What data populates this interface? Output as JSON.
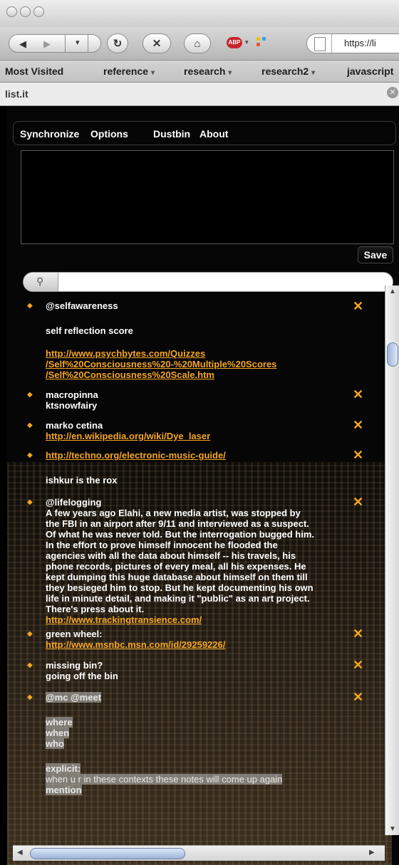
{
  "browser": {
    "url": "https://li",
    "adblock_label": "ABP",
    "bookmarks": [
      "Most Visited",
      "reference",
      "research",
      "research2",
      "javascript"
    ]
  },
  "sidebar": {
    "title": "list.it"
  },
  "menu": {
    "items": [
      "Synchronize",
      "Options",
      "Dustbin",
      "About"
    ]
  },
  "editor": {
    "save_label": "Save"
  },
  "notes": [
    {
      "lines": [
        "@selfawareness",
        "self reflection score"
      ],
      "links": [
        "http://www.psychbytes.com/Quizzes",
        "/Self%20Consciousness%20-%20Multiple%20Scores",
        "/Self%20Consciousness%20Scale.htm"
      ]
    },
    {
      "lines": [
        "macropinna",
        "ktsnowfairy"
      ]
    },
    {
      "lines": [
        "marko cetina"
      ],
      "links": [
        "http://en.wikipedia.org/wiki/Dye_laser"
      ]
    },
    {
      "links": [
        "http://techno.org/electronic-music-guide/"
      ],
      "lines": [
        "ishkur is the rox"
      ]
    },
    {
      "lines": [
        "@lifelogging",
        "A few years ago Elahi, a new media artist, was stopped by",
        "the FBI in an airport after 9/11 and interviewed as a suspect.",
        "Of what he was never told. But the interrogation bugged him.",
        "In the effort to prove himself innocent he flooded the",
        "agencies with all the data about himself -- his travels, his",
        "phone records, pictures of every meal, all his expenses. He",
        "kept dumping this huge database about himself on them till",
        "they besieged him to stop. But he kept documenting his own",
        "life in minute detail, and making it \"public\" as an art project.",
        "There's press about it."
      ],
      "links": [
        "http://www.trackingtransience.com/"
      ]
    },
    {
      "lines": [
        "green wheel:"
      ],
      "links": [
        "http://www.msnbc.msn.com/id/29259226/"
      ]
    },
    {
      "lines": [
        "missing bin?",
        "going off the bin"
      ]
    },
    {
      "lines": [
        "@mc @meet",
        "where",
        "when",
        "who",
        "explicit:",
        "when u r in these contexts these notes will come up again",
        "mention"
      ]
    }
  ],
  "colors": {
    "accent": "#f5a623",
    "panel_bg": "#060606",
    "text": "#ffffff"
  }
}
